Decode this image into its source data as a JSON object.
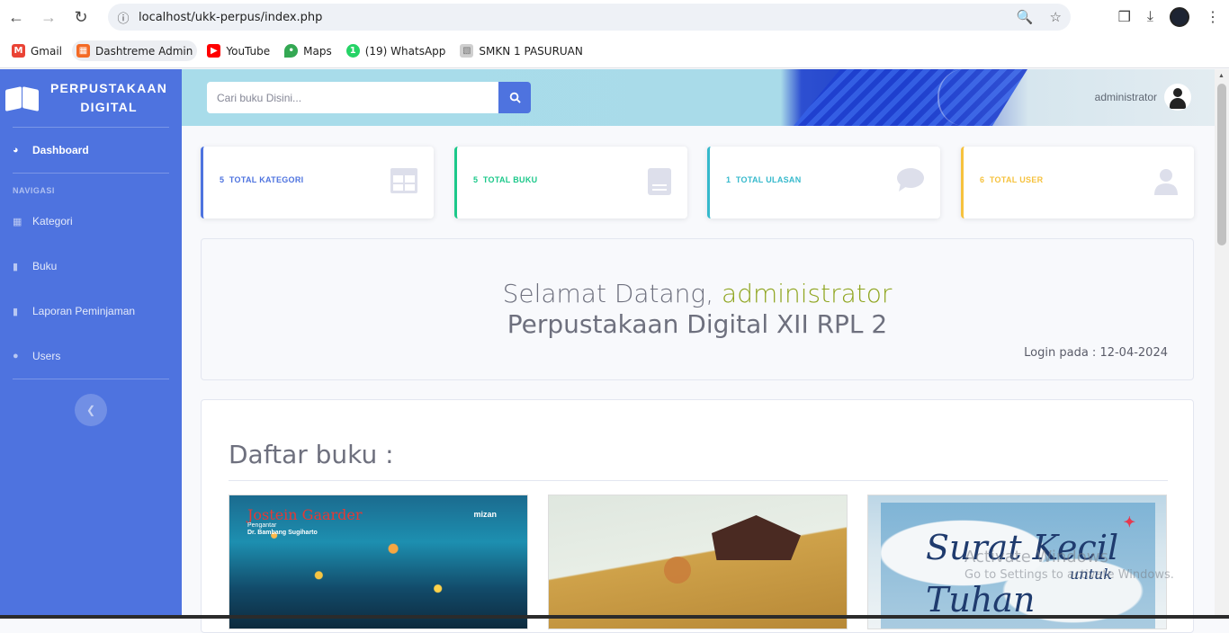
{
  "browser": {
    "url_host": "localhost",
    "url_path": "/ukk-perpus/index.php",
    "bookmarks": [
      {
        "label": "Gmail",
        "icon": "gmail-icon",
        "color": "#ea4335"
      },
      {
        "label": "Dashtreme Admin",
        "icon": "dashtreme-icon",
        "color": "#f46a25"
      },
      {
        "label": "YouTube",
        "icon": "youtube-icon",
        "color": "#ff0000"
      },
      {
        "label": "Maps",
        "icon": "maps-pin-icon",
        "color": "#34a853"
      },
      {
        "label": "(19) WhatsApp",
        "icon": "whatsapp-icon",
        "color": "#25d366"
      },
      {
        "label": "SMKN 1 PASURUAN",
        "icon": "school-icon",
        "color": "#9e9e9e"
      }
    ]
  },
  "sidebar": {
    "brand_line1": "PERPUSTAKAAN",
    "brand_line2": "DIGITAL",
    "dashboard_label": "Dashboard",
    "heading": "NAVIGASI",
    "items": [
      {
        "label": "Kategori",
        "icon": "table-icon"
      },
      {
        "label": "Buku",
        "icon": "book-icon"
      },
      {
        "label": "Laporan Peminjaman",
        "icon": "book-icon"
      },
      {
        "label": "Users",
        "icon": "user-icon"
      }
    ],
    "accent": "#4e73df"
  },
  "topbar": {
    "search_placeholder": "Cari buku Disini...",
    "username": "administrator"
  },
  "cards": [
    {
      "count": "5",
      "label": "TOTAL KATEGORI",
      "color": "#4e73df",
      "icon": "table-icon"
    },
    {
      "count": "5",
      "label": "TOTAL BUKU",
      "color": "#1cc88a",
      "icon": "book-icon"
    },
    {
      "count": "1",
      "label": "TOTAL ULASAN",
      "color": "#36b9cc",
      "icon": "comment-icon"
    },
    {
      "count": "6",
      "label": "TOTAL USER",
      "color": "#f6c23e",
      "icon": "user-icon"
    }
  ],
  "welcome": {
    "greeting": "Selamat Datang,",
    "username": "administrator",
    "subtitle": "Perpustakaan Digital XII RPL 2",
    "login_info": "Login pada : 12-04-2024"
  },
  "books": {
    "title": "Daftar buku :",
    "covers": [
      {
        "author": "Jostein Gaarder",
        "publisher": "mizan",
        "intro_line1": "Pengantar",
        "intro_line2": "Dr. Bambang Sugiharto"
      },
      {},
      {
        "title_line1": "Surat Kecil",
        "title_line2": "untuk",
        "title_line3": "Tuhan"
      }
    ]
  },
  "watermark": {
    "line1": "Activate Windows",
    "line2": "Go to Settings to activate Windows."
  }
}
